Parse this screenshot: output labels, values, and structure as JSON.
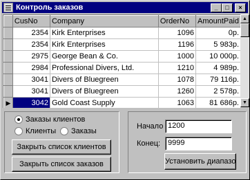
{
  "window": {
    "title": "Контроль заказов",
    "buttons": {
      "minimize": "_",
      "maximize": "□",
      "close": "×"
    }
  },
  "grid": {
    "columns": [
      "CusNo",
      "Company",
      "OrderNo",
      "AmountPaid"
    ],
    "rows": [
      {
        "cusno": "2354",
        "company": "Kirk Enterprises",
        "orderno": "1096",
        "amount": "0р."
      },
      {
        "cusno": "2354",
        "company": "Kirk Enterprises",
        "orderno": "1196",
        "amount": "5 983р."
      },
      {
        "cusno": "2975",
        "company": "George Bean & Co.",
        "orderno": "1000",
        "amount": "10 000р."
      },
      {
        "cusno": "2984",
        "company": "Professional Divers, Ltd.",
        "orderno": "1210",
        "amount": "4 989р."
      },
      {
        "cusno": "3041",
        "company": "Divers of Bluegreen",
        "orderno": "1078",
        "amount": "79 116р."
      },
      {
        "cusno": "3041",
        "company": "Divers of Bluegreen",
        "orderno": "1260",
        "amount": "2 578р."
      },
      {
        "cusno": "3042",
        "company": "Gold Coast Supply",
        "orderno": "1063",
        "amount": "81 686р."
      }
    ],
    "current_row_indicator": "▶"
  },
  "radios": {
    "orders_by_customer": "Заказы клиентов",
    "clients": "Клиенты",
    "orders": "Заказы"
  },
  "buttons": {
    "close_clients": "Закрыть список клиентов",
    "close_orders": "Закрыть список заказов",
    "set_range": "Установить диапазон"
  },
  "range": {
    "start_label": "Начало",
    "start_value": "1200",
    "end_label": "Конец:",
    "end_value": "9999"
  },
  "scrollbar": {
    "up": "▲",
    "down": "▼"
  }
}
